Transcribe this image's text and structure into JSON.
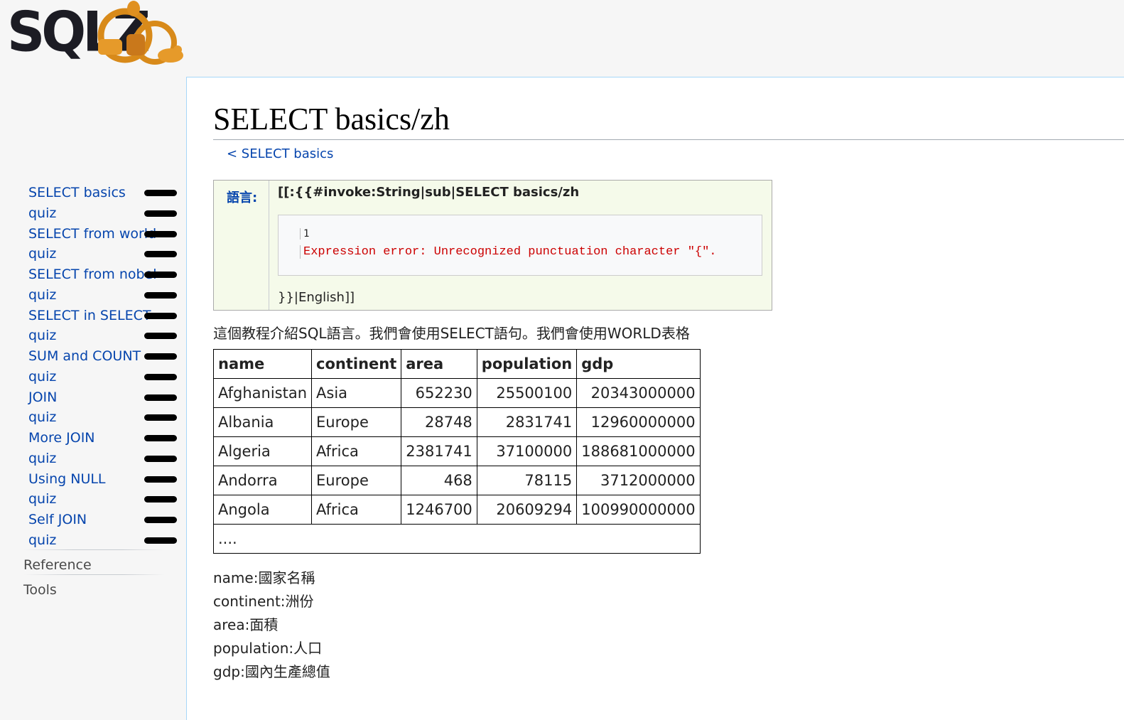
{
  "logo": {
    "text": "SQLZOO"
  },
  "sidebar": {
    "items": [
      {
        "label": "SELECT basics"
      },
      {
        "label": "quiz"
      },
      {
        "label": "SELECT from world"
      },
      {
        "label": "quiz"
      },
      {
        "label": "SELECT from nobel"
      },
      {
        "label": "quiz"
      },
      {
        "label": "SELECT in SELECT"
      },
      {
        "label": "quiz"
      },
      {
        "label": "SUM and COUNT"
      },
      {
        "label": "quiz"
      },
      {
        "label": "JOIN"
      },
      {
        "label": "quiz"
      },
      {
        "label": "More JOIN"
      },
      {
        "label": "quiz"
      },
      {
        "label": "Using NULL"
      },
      {
        "label": "quiz"
      },
      {
        "label": "Self JOIN"
      },
      {
        "label": "quiz"
      }
    ],
    "portals": [
      {
        "label": "Reference"
      },
      {
        "label": "Tools"
      }
    ]
  },
  "page": {
    "title": "SELECT basics/zh",
    "breadcrumb": "< SELECT basics"
  },
  "language_box": {
    "label": "語言:",
    "head": "[[:{{#invoke:String|sub|SELECT basics/zh",
    "error_line_no": "1",
    "error_text": "Expression error: Unrecognized punctuation character \"{\".",
    "tail": "}}|English]]"
  },
  "intro": "這個教程介紹SQL語言。我們會使用SELECT語句。我們會使用WORLD表格",
  "table": {
    "headers": [
      "name",
      "continent",
      "area",
      "population",
      "gdp"
    ],
    "rows": [
      [
        "Afghanistan",
        "Asia",
        "652230",
        "25500100",
        "20343000000"
      ],
      [
        "Albania",
        "Europe",
        "28748",
        "2831741",
        "12960000000"
      ],
      [
        "Algeria",
        "Africa",
        "2381741",
        "37100000",
        "188681000000"
      ],
      [
        "Andorra",
        "Europe",
        "468",
        "78115",
        "3712000000"
      ],
      [
        "Angola",
        "Africa",
        "1246700",
        "20609294",
        "100990000000"
      ]
    ],
    "more": "...."
  },
  "descriptions": [
    "name:國家名稱",
    "continent:洲份",
    "area:面積",
    "population:人口",
    "gdp:國內生產總值"
  ],
  "colors": {
    "link": "#0645ad",
    "error": "#cc0000",
    "lang_bg": "#f5faea",
    "border_accent": "#a7d7f9"
  }
}
